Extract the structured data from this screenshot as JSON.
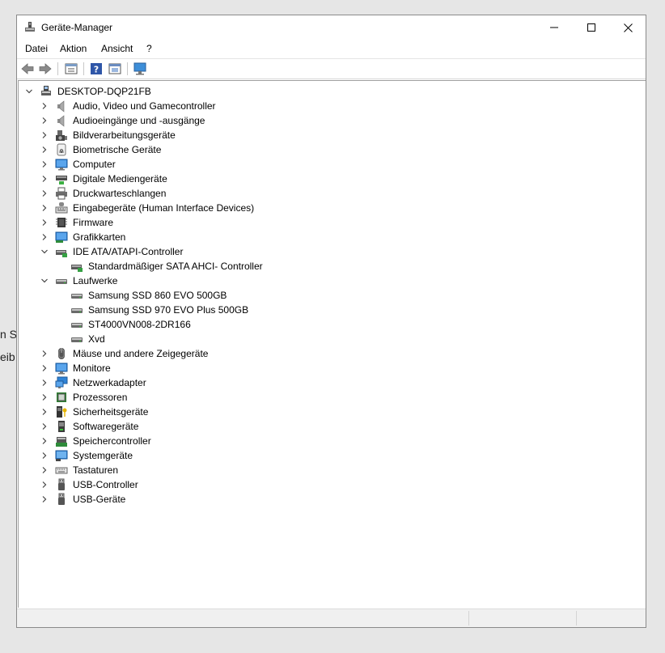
{
  "background": {
    "fragment1": "n S",
    "fragment2": "eib"
  },
  "window": {
    "title": "Geräte-Manager",
    "controls": {
      "minimize": "minimize-icon",
      "maximize": "maximize-icon",
      "close": "close-icon"
    }
  },
  "menu": [
    {
      "label": "Datei"
    },
    {
      "label": "Aktion"
    },
    {
      "label": "Ansicht"
    },
    {
      "label": "?"
    }
  ],
  "toolbar": [
    "back-arrow-icon",
    "forward-arrow-icon",
    "properties-icon",
    "help-icon",
    "update-driver-icon",
    "scan-monitor-icon"
  ],
  "tree": {
    "root": {
      "label": "DESKTOP-DQP21FB",
      "expanded": true
    },
    "items": [
      {
        "label": "Audio, Video und Gamecontroller",
        "icon": "speaker-icon",
        "level": 1,
        "state": "collapsed"
      },
      {
        "label": "Audioeingänge und -ausgänge",
        "icon": "speaker-icon",
        "level": 1,
        "state": "collapsed"
      },
      {
        "label": "Bildverarbeitungsgeräte",
        "icon": "camera-icon",
        "level": 1,
        "state": "collapsed"
      },
      {
        "label": "Biometrische Geräte",
        "icon": "fingerprint-icon",
        "level": 1,
        "state": "collapsed"
      },
      {
        "label": "Computer",
        "icon": "monitor-icon",
        "level": 1,
        "state": "collapsed"
      },
      {
        "label": "Digitale Mediengeräte",
        "icon": "media-device-icon",
        "level": 1,
        "state": "collapsed"
      },
      {
        "label": "Druckwarteschlangen",
        "icon": "printer-icon",
        "level": 1,
        "state": "collapsed"
      },
      {
        "label": "Eingabegeräte (Human Interface Devices)",
        "icon": "hid-icon",
        "level": 1,
        "state": "collapsed"
      },
      {
        "label": "Firmware",
        "icon": "chip-icon",
        "level": 1,
        "state": "collapsed"
      },
      {
        "label": "Grafikkarten",
        "icon": "display-adapter-icon",
        "level": 1,
        "state": "collapsed"
      },
      {
        "label": "IDE ATA/ATAPI-Controller",
        "icon": "ide-controller-icon",
        "level": 1,
        "state": "expanded"
      },
      {
        "label": "Standardmäßiger SATA AHCI- Controller",
        "icon": "ide-controller-icon",
        "level": 2,
        "state": "leaf"
      },
      {
        "label": "Laufwerke",
        "icon": "drive-icon",
        "level": 1,
        "state": "expanded"
      },
      {
        "label": "Samsung SSD 860 EVO 500GB",
        "icon": "drive-icon",
        "level": 2,
        "state": "leaf"
      },
      {
        "label": "Samsung SSD 970 EVO Plus 500GB",
        "icon": "drive-icon",
        "level": 2,
        "state": "leaf"
      },
      {
        "label": "ST4000VN008-2DR166",
        "icon": "drive-icon",
        "level": 2,
        "state": "leaf"
      },
      {
        "label": "Xvd",
        "icon": "drive-icon",
        "level": 2,
        "state": "leaf"
      },
      {
        "label": "Mäuse und andere Zeigegeräte",
        "icon": "mouse-icon",
        "level": 1,
        "state": "collapsed"
      },
      {
        "label": "Monitore",
        "icon": "monitor-icon",
        "level": 1,
        "state": "collapsed"
      },
      {
        "label": "Netzwerkadapter",
        "icon": "network-icon",
        "level": 1,
        "state": "collapsed"
      },
      {
        "label": "Prozessoren",
        "icon": "cpu-icon",
        "level": 1,
        "state": "collapsed"
      },
      {
        "label": "Sicherheitsgeräte",
        "icon": "security-key-icon",
        "level": 1,
        "state": "collapsed"
      },
      {
        "label": "Softwaregeräte",
        "icon": "software-device-icon",
        "level": 1,
        "state": "collapsed"
      },
      {
        "label": "Speichercontroller",
        "icon": "storage-controller-icon",
        "level": 1,
        "state": "collapsed"
      },
      {
        "label": "Systemgeräte",
        "icon": "system-device-icon",
        "level": 1,
        "state": "collapsed"
      },
      {
        "label": "Tastaturen",
        "icon": "keyboard-icon",
        "level": 1,
        "state": "collapsed"
      },
      {
        "label": "USB-Controller",
        "icon": "usb-icon",
        "level": 1,
        "state": "collapsed"
      },
      {
        "label": "USB-Geräte",
        "icon": "usb-icon",
        "level": 1,
        "state": "collapsed"
      }
    ]
  },
  "colors": {
    "selection": "#cce8ff",
    "selection_border": "#99d1ff",
    "window_border": "#8a8a8a"
  }
}
